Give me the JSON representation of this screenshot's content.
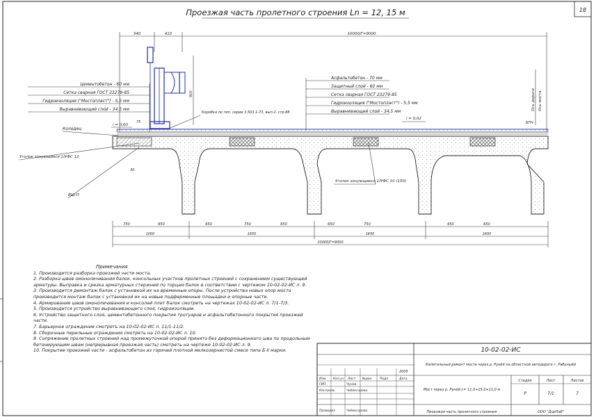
{
  "sheet_number": "18",
  "title": "Проезжая часть пролетного строения Ln = 12, 15 м",
  "dims_top": {
    "left_a": "340",
    "left_b": "410",
    "overall": "10000/Г=9000"
  },
  "left_layers": [
    "Цементобетон - 60 мм",
    "Сетка сварная ГОСТ 23279-85",
    "Гидроизоляция (\"Мостопласт\") - 5,5 мм",
    "Выравнивающий слой - 34,5 мм"
  ],
  "right_layers": [
    "Асфальтобетон - 70 мм",
    "Защитный слой - 60 мм",
    "Сетка сварная ГОСТ 23279-85",
    "Гидроизоляция (\"Мостопласт\") - 5,5 мм",
    "Выравнивающий слой - 34,5 мм"
  ],
  "labels": {
    "kerb": "Колодец",
    "slope_left": "i = 0,00",
    "slope_right": "i = 0,02",
    "drain_note": "Коробка по тип. серии 3.503.1-73, вып.2, стр.88",
    "reinf_left": "Уголок зонующиеся 1/УФС 12",
    "reinf_right": "Уголок зонующиеся 1/УФС 10 (150)",
    "seal": "ВШ-П",
    "axis_a": "Ось дороги",
    "axis_b": "Ось моста",
    "wp": "БПЧ",
    "vert_dim": "910",
    "vert_dim2": "75",
    "vert_dim3": "30"
  },
  "dims_bottom_row1": [
    "750",
    "650",
    "650",
    "750",
    "650",
    "650",
    "750",
    "650",
    "650"
  ],
  "dims_bottom_row2": [
    "1000",
    "1650",
    "1650",
    "1650"
  ],
  "dims_bottom_total": "10000/Г=9000",
  "notes_heading": "Примечания",
  "notes": [
    "1. Производится разборка проезжей части моста.",
    "2. Разборка швов омоноличивания балок, консольных участков пролетных строений с сохранением существующей арматуры. Выправка и срезка арматурных стержней по торцам балок в соответствии с чертежом 10-02-02-ИС л. 9.",
    "3. Производится демонтаж балок с установкой их на временные опоры. После устройства новых опор моста производится монтаж балок с установкой их на новые подферменные площадки и опорные части.",
    "4. Армирование швов омоноличивания и консолей плит балок смотреть на чертежах 10-02-02-ИС л. 7/1-7/3.",
    "5. Производится устройство выравнивающего слоя, гидроизоляции.",
    "6. Устройство защитного слоя, цементобетонного покрытия тротуаров и асфальтобетонного покрытия проезжей части.",
    "7. Барьерное ограждение смотреть на 10-02-02-ИС л. 11/1-11/2.",
    "8. Сборочные перильные ограждения смотреть на 10-02-02-ИС л. 10.",
    "9. Сопряжение пролетных строений над промежуточной опорой принято без деформационного шва по продольным бетонирующим швам (непрерывная проезжая часть) смотреть на чертеже 10-02-02-ИС л. 9.",
    "10. Покрытие проезжей части - асфальтобетон из горячей плотной мелкозернистой смеси типа Б II марки."
  ],
  "stamp": {
    "code": "10-02-02-ИС",
    "project": "Капитальный ремонт моста через р. Рунёй на областной автодороге г. Рабуныёй",
    "year": "2005",
    "heads": [
      "Изм.",
      "Кол.уч",
      "Лист",
      "№док.",
      "Подп.",
      "Дата"
    ],
    "roles": [
      {
        "role": "ГИП",
        "name": "Чунов"
      },
      {
        "role": "Контроль",
        "name": "Чебоксарова"
      },
      {
        "role": "Проверил",
        "name": "Чебоксарова"
      }
    ],
    "object": "Мост через р. Рунёй L= 11,0+15,0+11,0 м",
    "stage_head": "Стадия",
    "sheet_head": "Лист",
    "sheets_head": "Листов",
    "stage": "Р",
    "sheet": "7/1",
    "sheets": "7",
    "drawing_name": "Проезжая часть пролетного строения",
    "org": "ООО \"ДорЛаб\""
  }
}
